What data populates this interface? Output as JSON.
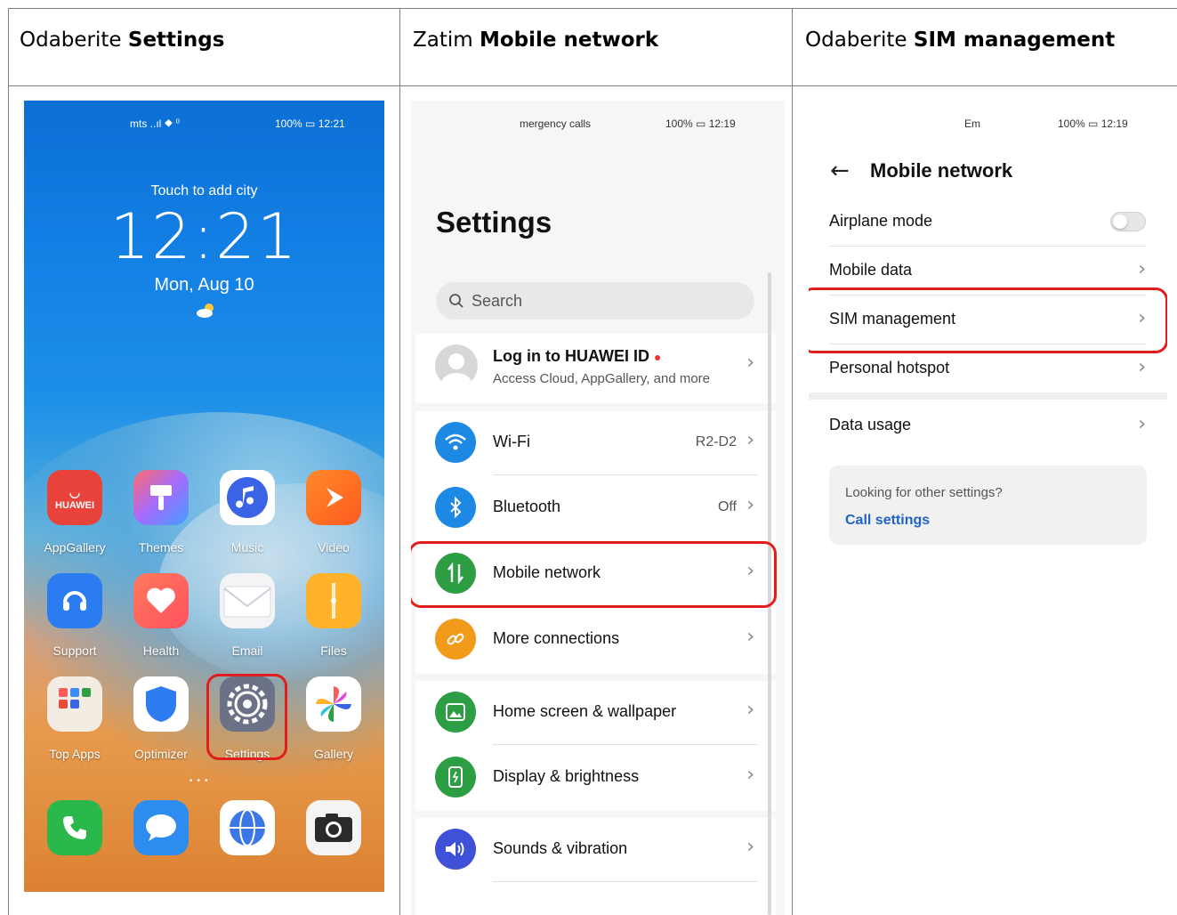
{
  "columns": [
    {
      "prefix": "Odaberite",
      "bold": "Settings"
    },
    {
      "prefix": "Zatim",
      "bold": "Mobile network"
    },
    {
      "prefix": "Odaberite",
      "bold": "SIM management"
    }
  ],
  "home": {
    "status_left": "mts ..ıl ⯁ ⁰",
    "status_right": "100% ▭ 12:21",
    "touch_city": "Touch to add city",
    "time": "12:21",
    "date": "Mon, Aug 10",
    "apps": [
      {
        "label": "AppGallery",
        "badge": "HUAWEI"
      },
      {
        "label": "Themes"
      },
      {
        "label": "Music"
      },
      {
        "label": "Video"
      },
      {
        "label": "Support"
      },
      {
        "label": "Health"
      },
      {
        "label": "Email"
      },
      {
        "label": "Files"
      },
      {
        "label": "Top Apps"
      },
      {
        "label": "Optimizer"
      },
      {
        "label": "Settings"
      },
      {
        "label": "Gallery"
      }
    ]
  },
  "settings": {
    "status_left": "mergency calls",
    "status_right": "100% ▭ 12:19",
    "title": "Settings",
    "search_placeholder": "Search",
    "account_title": "Log in to HUAWEI ID",
    "account_sub": "Access Cloud, AppGallery, and more",
    "rows": [
      {
        "label": "Wi-Fi",
        "value": "R2-D2",
        "color": "#1e88e5"
      },
      {
        "label": "Bluetooth",
        "value": "Off",
        "color": "#1e88e5"
      },
      {
        "label": "Mobile network",
        "value": "",
        "color": "#2e9e44"
      },
      {
        "label": "More connections",
        "value": "",
        "color": "#f29a1a"
      },
      {
        "label": "Home screen & wallpaper",
        "value": "",
        "color": "#2e9e44"
      },
      {
        "label": "Display & brightness",
        "value": "",
        "color": "#2e9e44"
      },
      {
        "label": "Sounds & vibration",
        "value": "",
        "color": "#3f51d8"
      }
    ]
  },
  "mobile_network": {
    "status_left": "Em",
    "status_right": "100% ▭ 12:19",
    "title": "Mobile network",
    "rows": [
      {
        "label": "Airplane mode"
      },
      {
        "label": "Mobile data"
      },
      {
        "label": "SIM management"
      },
      {
        "label": "Personal hotspot"
      },
      {
        "label": "Data usage"
      }
    ],
    "looking_text": "Looking for other settings?",
    "call_settings": "Call settings"
  },
  "accent": "#e11d1d"
}
